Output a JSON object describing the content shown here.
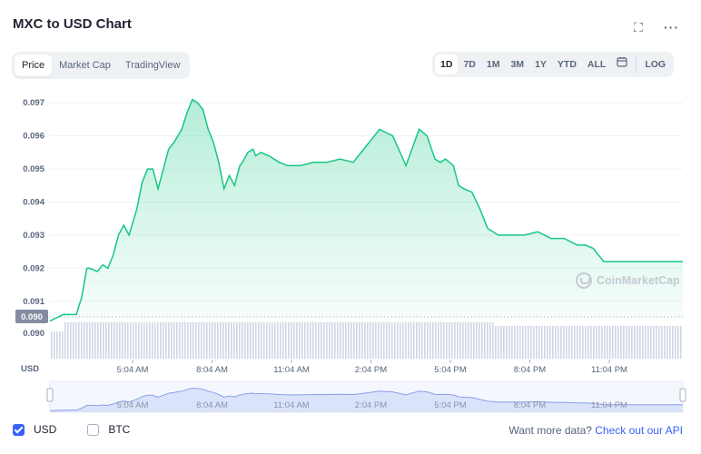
{
  "header": {
    "title": "MXC to USD Chart",
    "expand_icon": "expand-icon",
    "more_icon": "more-icon"
  },
  "metric_tabs": [
    {
      "label": "Price",
      "active": true
    },
    {
      "label": "Market Cap",
      "active": false
    },
    {
      "label": "TradingView",
      "active": false
    }
  ],
  "range_tabs": [
    {
      "label": "1D",
      "active": true
    },
    {
      "label": "7D",
      "active": false
    },
    {
      "label": "1M",
      "active": false
    },
    {
      "label": "3M",
      "active": false
    },
    {
      "label": "1Y",
      "active": false
    },
    {
      "label": "YTD",
      "active": false
    },
    {
      "label": "ALL",
      "active": false
    }
  ],
  "calendar_icon": "calendar-icon",
  "log_label": "LOG",
  "watermark": "CoinMarketCap",
  "chart_data": {
    "type": "area",
    "currency_label": "USD",
    "y_ticks": [
      "0.097",
      "0.096",
      "0.095",
      "0.094",
      "0.093",
      "0.092",
      "0.091"
    ],
    "price_marker": "0.090",
    "volume_axis_label": "0.090",
    "ylim": [
      0.0905,
      0.0975
    ],
    "x_ticks": [
      "5:04 AM",
      "8:04 AM",
      "11:04 AM",
      "2:04 PM",
      "5:04 PM",
      "8:04 PM",
      "11:04 PM"
    ],
    "x": [
      0,
      0.5,
      1,
      1.2,
      1.4,
      1.5,
      1.8,
      2,
      2.2,
      2.4,
      2.6,
      2.8,
      3,
      3.3,
      3.5,
      3.7,
      3.9,
      4.1,
      4.3,
      4.5,
      4.7,
      5,
      5.2,
      5.4,
      5.6,
      5.8,
      6,
      6.2,
      6.4,
      6.6,
      6.8,
      7,
      7.2,
      7.3,
      7.5,
      7.7,
      7.8,
      8,
      8.3,
      8.7,
      9,
      9.5,
      10,
      10.5,
      11,
      11.5,
      12,
      12.5,
      13,
      13.5,
      14,
      14.3,
      14.6,
      14.8,
      15,
      15.3,
      15.5,
      15.7,
      16,
      16.3,
      16.6,
      16.8,
      17,
      17.5,
      18,
      18.5,
      19,
      19.5,
      20,
      20.3,
      20.6,
      21,
      21.5,
      22,
      22.5,
      23,
      23.5,
      24
    ],
    "values": [
      0.0904,
      0.0906,
      0.0906,
      0.0911,
      0.092,
      0.092,
      0.0919,
      0.0921,
      0.092,
      0.0924,
      0.093,
      0.0933,
      0.093,
      0.0938,
      0.0946,
      0.095,
      0.095,
      0.0944,
      0.095,
      0.0956,
      0.0958,
      0.0962,
      0.0967,
      0.0971,
      0.097,
      0.0968,
      0.0962,
      0.0958,
      0.0952,
      0.0944,
      0.0948,
      0.0945,
      0.0951,
      0.0952,
      0.0955,
      0.0956,
      0.0954,
      0.0955,
      0.0954,
      0.0952,
      0.0951,
      0.0951,
      0.0952,
      0.0952,
      0.0953,
      0.0952,
      0.0957,
      0.0962,
      0.096,
      0.0951,
      0.0962,
      0.096,
      0.0953,
      0.0952,
      0.0953,
      0.0951,
      0.0945,
      0.0944,
      0.0943,
      0.0938,
      0.0932,
      0.0931,
      0.093,
      0.093,
      0.093,
      0.0931,
      0.0929,
      0.0929,
      0.0927,
      0.0927,
      0.0926,
      0.0922,
      0.0922,
      0.0922,
      0.0922,
      0.0922,
      0.0922,
      0.0922
    ],
    "series_color": "#16c784",
    "volume_color": "#cfd6e4",
    "grid": true
  },
  "footer": {
    "usd_label": "USD",
    "usd_checked": true,
    "btc_label": "BTC",
    "btc_checked": false,
    "api_prefix": "Want more data?",
    "api_link": "Check out our API"
  },
  "colors": {
    "accent": "#3861fb",
    "positive": "#16c784",
    "muted": "#58667e"
  }
}
